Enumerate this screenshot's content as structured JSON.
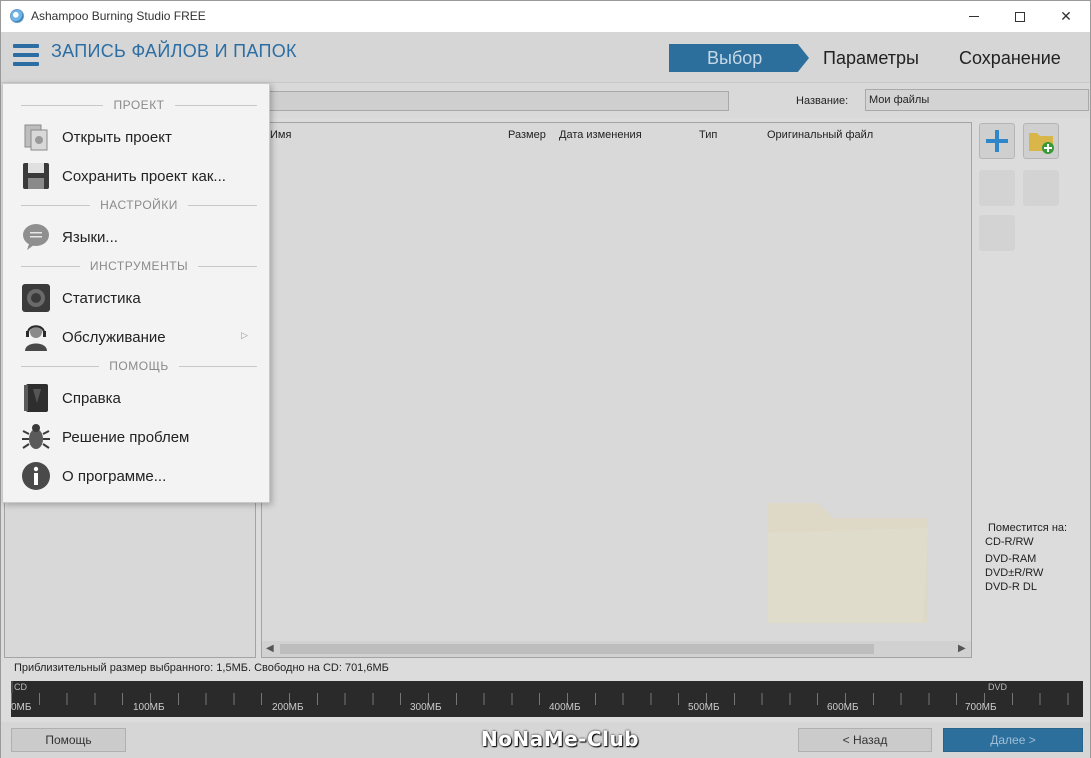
{
  "window": {
    "title": "Ashampoo Burning Studio FREE"
  },
  "header": {
    "page_title": "ЗАПИСЬ ФАЙЛОВ И ПАПОК",
    "steps": [
      "Выбор",
      "Параметры",
      "Сохранение"
    ],
    "active_step": "Выбор"
  },
  "subbar": {
    "name_label": "Название:",
    "name_value": "Мои файлы"
  },
  "file_list": {
    "columns": [
      "Имя",
      "Размер",
      "Дата изменения",
      "Тип",
      "Оригинальный файл"
    ]
  },
  "fits": {
    "label": "Поместится на:",
    "items": [
      "CD-R/RW",
      "DVD-RAM",
      "DVD±R/RW",
      "DVD-R DL"
    ]
  },
  "status": {
    "text": "Приблизительный размер выбранного: 1,5МБ. Свободно на CD: 701,6МБ"
  },
  "capacity": {
    "cd_label": "CD",
    "dvd_label": "DVD",
    "used_mb": 1.5,
    "scale_labels": [
      "0МБ",
      "100МБ",
      "200МБ",
      "300МБ",
      "400МБ",
      "500МБ",
      "600МБ",
      "700МБ"
    ]
  },
  "footer": {
    "help_label": "Помощь",
    "watermark": "NoNaMe-Club",
    "back_label": "< Назад",
    "next_label": "Далее >"
  },
  "menu": {
    "sections": {
      "project": "ПРОЕКТ",
      "settings": "НАСТРОЙКИ",
      "tools": "ИНСТРУМЕНТЫ",
      "help": "ПОМОЩЬ"
    },
    "items": {
      "open_project": "Открыть проект",
      "save_project": "Сохранить проект как...",
      "languages": "Языки...",
      "statistics": "Статистика",
      "maintenance": "Обслуживание",
      "help": "Справка",
      "troubleshoot": "Решение проблем",
      "about": "О программе..."
    }
  },
  "colors": {
    "accent": "#2c6ea3",
    "active_step": "#2d6f9c"
  }
}
